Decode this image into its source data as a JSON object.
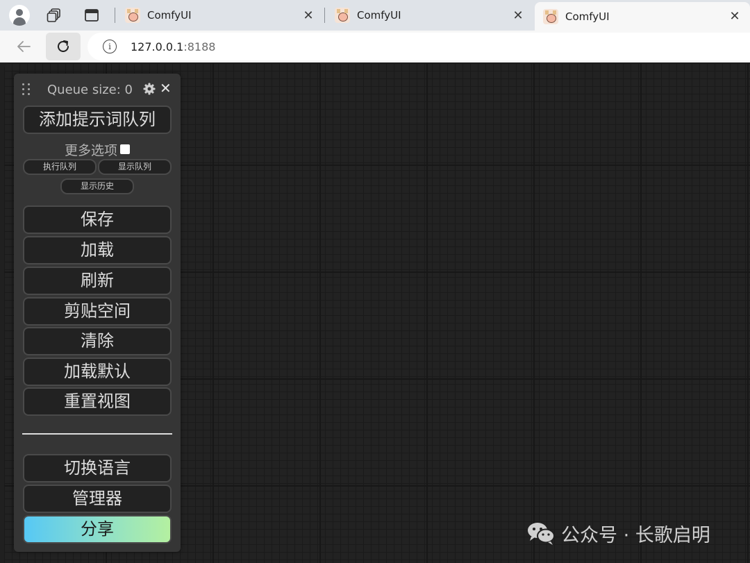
{
  "browser": {
    "tabs": [
      {
        "title": "ComfyUI",
        "active": false
      },
      {
        "title": "ComfyUI",
        "active": false
      },
      {
        "title": "ComfyUI",
        "active": true
      }
    ],
    "tab_close_symbol": "✕",
    "url_host": "127.0.0.1",
    "url_port": ":8188",
    "icons": {
      "profile": "profile-icon",
      "workspaces": "workspaces-icon",
      "vertical_tabs": "vertical-tabs-icon",
      "back": "back-arrow-icon",
      "reload": "reload-icon",
      "site_info": "info-icon"
    }
  },
  "menu": {
    "queue_label": "Queue size: 0",
    "close_symbol": "✕",
    "queue_prompt": "添加提示词队列",
    "more_options": "更多选项",
    "more_options_checked": false,
    "view_queue": "执行队列",
    "show_queue": "显示队列",
    "show_history": "显示历史",
    "save": "保存",
    "load": "加载",
    "refresh": "刷新",
    "clipspace": "剪贴空间",
    "clear": "清除",
    "load_default": "加载默认",
    "reset_view": "重置视图",
    "switch_language": "切换语言",
    "manager": "管理器",
    "share": "分享",
    "share_gradient": [
      "#56c8f5",
      "#b4f0a0"
    ]
  },
  "watermark": {
    "text": "公众号 · 长歌启明"
  },
  "colors": {
    "canvas_bg": "#222222",
    "menu_bg": "#353535",
    "button_bg": "#222222",
    "tab_strip": "#dfe3e8"
  }
}
